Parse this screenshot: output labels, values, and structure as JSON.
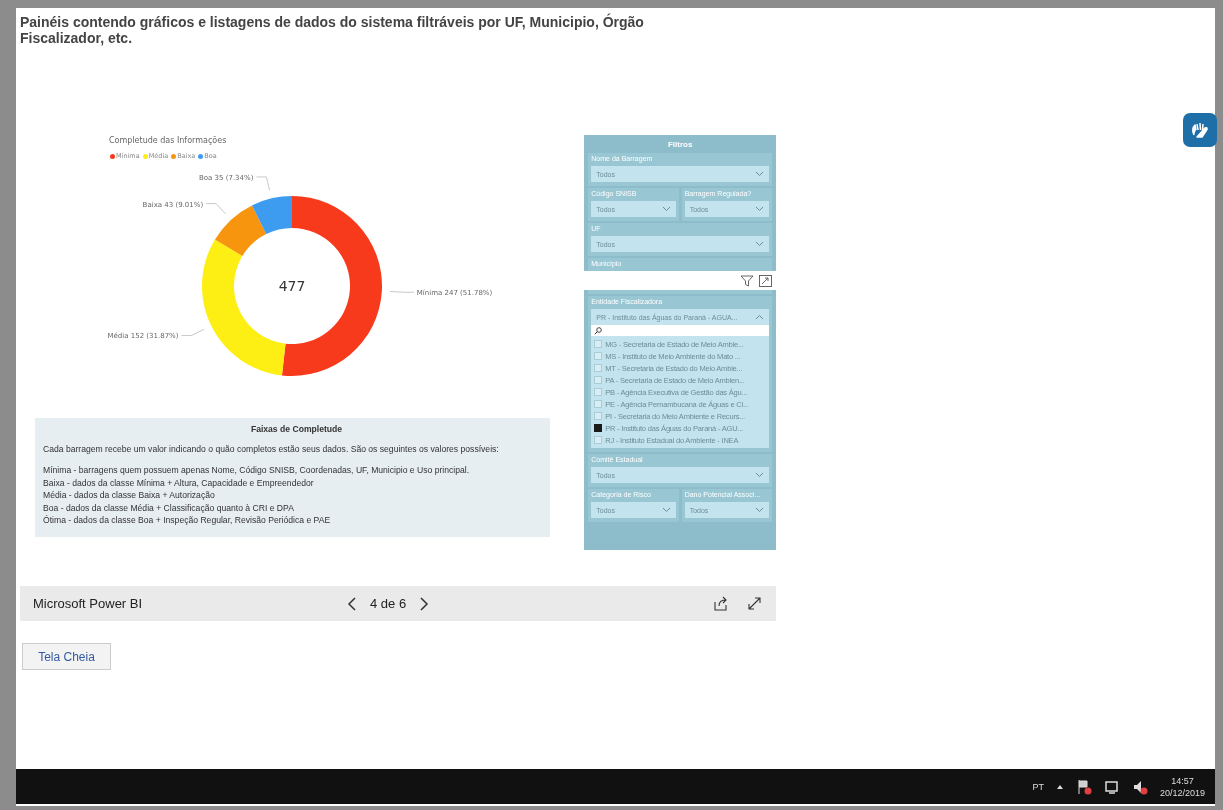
{
  "page_title": "Painéis contendo gráficos e listagens de dados do sistema filtráveis por UF, Municipio, Órgão Fiscalizador, etc.",
  "chart": {
    "chart_data": {
      "type": "donut",
      "title": "Completude das Informações",
      "categories": [
        "Mínima",
        "Média",
        "Baixa",
        "Boa"
      ],
      "values": [
        247,
        152,
        43,
        35
      ],
      "colors": [
        "#f83a1c",
        "#fdee13",
        "#f7950f",
        "#3d9cf0"
      ],
      "legend": "top-left",
      "value_labels": [
        "Mínima 247 (51.78%)",
        "Média 152 (31.87%)",
        "Baixa 43 (9.01%)",
        "Boa 35 (7.34%)"
      ]
    },
    "center_label": "477"
  },
  "info_box": {
    "title": "Faixas de Completude",
    "intro": "Cada barragem recebe um valor indicando o quão completos estão seus dados. São os seguintes os valores possíveis:",
    "lines": [
      "Mínima - barragens quem possuem apenas Nome, Código SNISB, Coordenadas, UF, Municipio e Uso principal.",
      "Baixa - dados da classe Mínima + Altura, Capacidade e Empreendedor",
      "Média - dados da classe Baixa + Autorização",
      "Boa - dados da classe Média + Classificação quanto à CRI e DPA",
      "Ótima - dados da classe Boa + Inspeção Regular, Revisão Periódica e PAE"
    ]
  },
  "filters": {
    "title": "Filtros",
    "rows": [
      [
        {
          "label": "Nome da Barragem",
          "value": "Todos",
          "open": false,
          "hovered": false
        }
      ],
      [
        {
          "label": "Código SNISB",
          "value": "Todos",
          "open": false,
          "hovered": false
        },
        {
          "label": "Barragem Regulada?",
          "value": "Todos",
          "open": false,
          "hovered": false
        }
      ],
      [
        {
          "label": "UF",
          "value": "Todos",
          "open": false,
          "hovered": false
        }
      ],
      [
        {
          "label": "Município",
          "open": false,
          "hovered": true
        }
      ],
      [
        {
          "label": "Entidade Fiscalizadora",
          "value": "PR - Instituto das Águas do Paraná - AGUA...",
          "open": true,
          "hovered": false,
          "options": [
            {
              "label": "MG - Secretaria de Estado de Meio Ambie...",
              "checked": false
            },
            {
              "label": "MS - Instituto de Meio Ambiente do Mato ...",
              "checked": false
            },
            {
              "label": "MT - Secretaria de Estado do Meio Ambie...",
              "checked": false
            },
            {
              "label": "PA - Secretaria de Estado de Meio Ambien...",
              "checked": false
            },
            {
              "label": "PB - Agência Executiva de Gestão das Águ...",
              "checked": false
            },
            {
              "label": "PE - Agência Pernambucana de Águas e Cl...",
              "checked": false
            },
            {
              "label": "PI - Secretaria do Meio Ambiente e Recurs...",
              "checked": false
            },
            {
              "label": "PR - Instituto das Águas do Paraná - AGU...",
              "checked": true
            },
            {
              "label": "RJ - Instituto Estadual do Ambiente - INEA",
              "checked": false
            }
          ]
        }
      ],
      [
        {
          "label": "Comitê Estadual",
          "value": "Todos",
          "open": false,
          "hovered": false
        }
      ],
      [
        {
          "label": "Categoria de Risco",
          "value": "Todos",
          "open": false,
          "hovered": false
        },
        {
          "label": "Dano Potencial Associ...",
          "value": "Todos",
          "open": false,
          "hovered": false
        }
      ]
    ]
  },
  "powerbi_bar": {
    "brand": "Microsoft Power BI",
    "page_indicator": "4 de 6"
  },
  "fullscreen_button": "Tela Cheia",
  "taskbar": {
    "language": "PT",
    "time": "14:57",
    "date": "20/12/2019"
  }
}
